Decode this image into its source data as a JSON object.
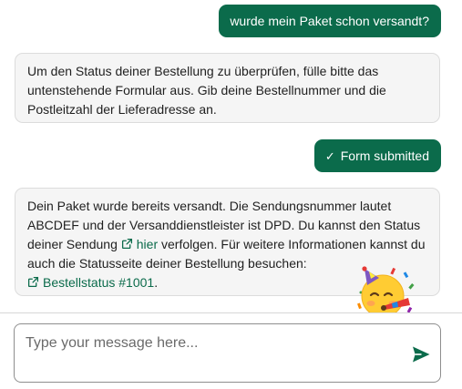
{
  "messages": {
    "user_1": "wurde mein Paket schon versandt?",
    "bot_1": "Um den Status deiner Bestellung zu überprüfen, fülle bitte das untenstehende Formular aus. Gib deine Bestellnummer und die Postleitzahl der Lieferadresse an.",
    "form_submitted": {
      "check_glyph": "✓",
      "label": "Form submitted"
    },
    "bot_2": {
      "text_part1": "Dein Paket wurde bereits versandt. Die Sendungsnummer lautet ABCDEF und der Versanddienstleister ist DPD. Du kannst den Status deiner Sendung ",
      "link_1": "hier",
      "text_part2": " verfolgen. Für weitere Informationen kannst du auch die Statusseite deiner Bestellung besuchen:",
      "link_2": "Bestellstatus #1001",
      "text_part3": "."
    }
  },
  "composer": {
    "placeholder": "Type your message here...",
    "value": ""
  },
  "icons": {
    "external_link": "external-link-icon",
    "send": "send-icon",
    "emoji": "partying-face-emoji"
  },
  "colors": {
    "accent": "#0b6b4b",
    "bot_bubble_bg": "#f5f5f5",
    "bot_bubble_border": "#dcdcdc",
    "divider": "#d7d7d7"
  }
}
